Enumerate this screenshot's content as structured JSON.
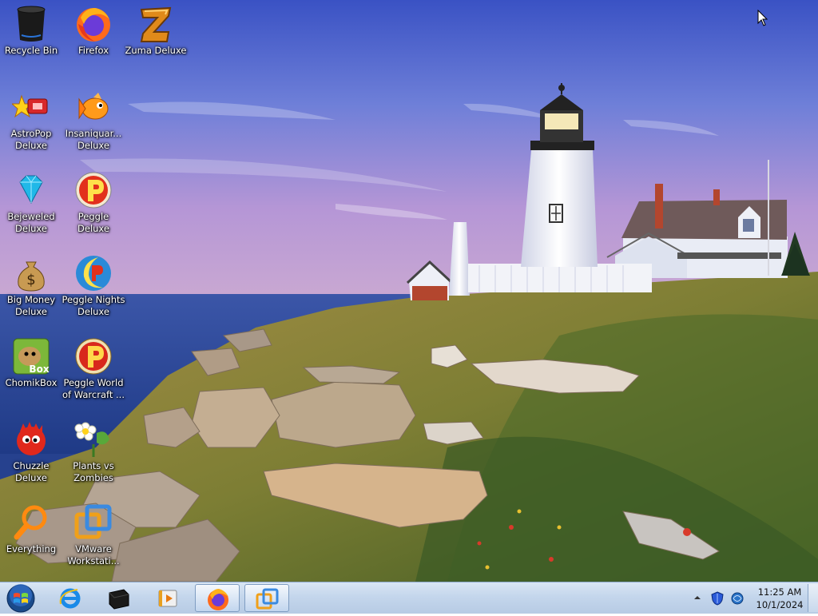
{
  "desktop": {
    "icons": [
      {
        "label": "Recycle Bin"
      },
      {
        "label": "Firefox"
      },
      {
        "label": "Zuma Deluxe"
      },
      {
        "label": "AstroPop Deluxe"
      },
      {
        "label": "Insaniquar... Deluxe"
      },
      {
        "label": "Bejeweled Deluxe"
      },
      {
        "label": "Peggle Deluxe"
      },
      {
        "label": "Big Money Deluxe"
      },
      {
        "label": "Peggle Nights Deluxe"
      },
      {
        "label": "ChomikBox"
      },
      {
        "label": "Peggle World of Warcraft ..."
      },
      {
        "label": "Chuzzle Deluxe"
      },
      {
        "label": "Plants vs Zombies"
      },
      {
        "label": "Everything"
      },
      {
        "label": "VMware Workstati..."
      }
    ],
    "colors": {
      "sky_top": "#3c56c8",
      "sea": "#26418e",
      "grass": "#8c8a3a"
    }
  },
  "taskbar": {
    "clock": {
      "time": "11:25 AM",
      "date": "10/1/2024"
    },
    "items": [
      "start-orb",
      "internet-explorer",
      "terminal",
      "media-player",
      "firefox",
      "vmware-workstation"
    ],
    "tray_icons": [
      "show-hidden-icons-chevron",
      "shield-icon",
      "network-icon"
    ]
  }
}
